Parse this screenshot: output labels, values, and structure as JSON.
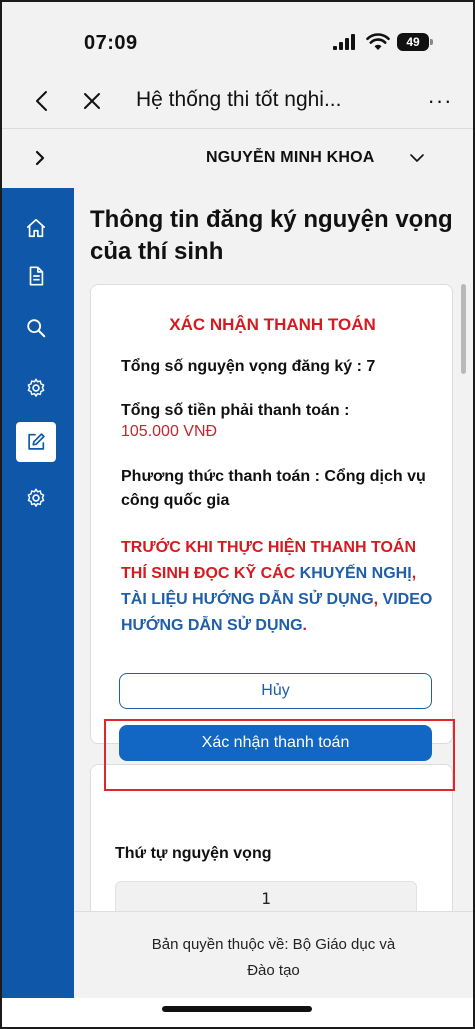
{
  "status_bar": {
    "time": "07:09",
    "battery": "49",
    "icons": [
      "signal-icon",
      "wifi-icon",
      "battery-icon"
    ]
  },
  "browser": {
    "title": "Hệ thống thi tốt nghi...",
    "more_label": "···",
    "icons": [
      "back-icon",
      "close-icon",
      "more-icon"
    ]
  },
  "user": {
    "name": "NGUYỄN MINH KHOA"
  },
  "sidenav": {
    "items": [
      {
        "icon": "home-icon",
        "active": false
      },
      {
        "icon": "document-icon",
        "active": false
      },
      {
        "icon": "search-icon",
        "active": false
      },
      {
        "icon": "gear-icon",
        "active": false
      },
      {
        "icon": "edit-icon",
        "active": true
      },
      {
        "icon": "gear-icon",
        "active": false
      }
    ],
    "color": "#0f57a8"
  },
  "main": {
    "heading": "Thông tin đăng ký nguyện vọng của thí sinh",
    "payment": {
      "title": "XÁC NHẬN THANH TOÁN",
      "total_wishes": "Tổng số nguyện vọng đăng ký : 7",
      "total_amount_label": "Tổng số tiền phải thanh toán :",
      "total_amount": "105.000 VNĐ",
      "method": "Phương thức thanh toán : Cổng dịch vụ công quốc gia",
      "warning": {
        "part1": "TRƯỚC KHI THỰC HIỆN THANH TOÁN THÍ SINH ĐỌC KỸ CÁC ",
        "part2": "KHUYẾN NGHỊ",
        "part3": ", ",
        "part4": "TÀI LIỆU HƯỚNG DẪN SỬ DỤNG",
        "part5": ", ",
        "part6": "VIDEO HƯỚNG DẪN SỬ DỤNG",
        "part7": "."
      },
      "cancel_label": "Hủy",
      "confirm_label": "Xác nhận thanh toán"
    },
    "order": {
      "label": "Thứ tự nguyện vọng",
      "value": "1"
    }
  },
  "footer": {
    "line1": "Bản quyền thuộc về: Bộ Giáo dục và",
    "line2": "Đào tạo"
  },
  "colors": {
    "accent": "#1167c3",
    "red": "#d71920",
    "highlight": "#e0252b"
  }
}
